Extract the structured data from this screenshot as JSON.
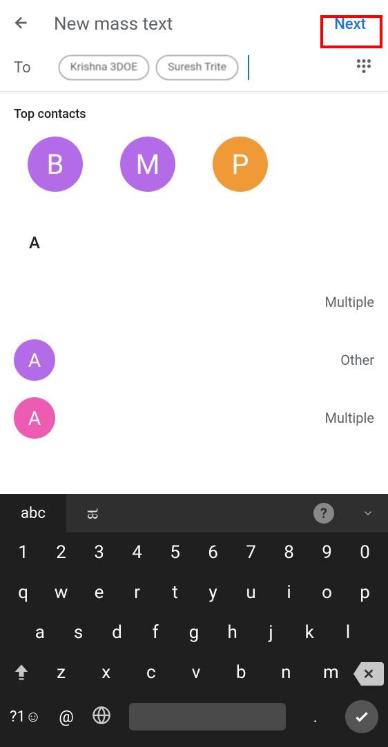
{
  "header": {
    "title": "New mass text",
    "next": "Next"
  },
  "to_label": "To",
  "chips": [
    "Krishna 3DOE",
    "Suresh Trite"
  ],
  "top_contacts_label": "Top contacts",
  "top_contacts": [
    {
      "initial": "B",
      "color": "#b46be8"
    },
    {
      "initial": "M",
      "color": "#b46be8"
    },
    {
      "initial": "P",
      "color": "#f09a37"
    }
  ],
  "section_letter": "A",
  "contacts": [
    {
      "initial": "",
      "color": "transparent",
      "type": "Multiple"
    },
    {
      "initial": "A",
      "color": "#b46be8",
      "type": "Other"
    },
    {
      "initial": "A",
      "color": "#ec5cb2",
      "type": "Multiple"
    }
  ],
  "keyboard": {
    "mode": "abc",
    "lang": "ಹ",
    "row1": [
      "1",
      "2",
      "3",
      "4",
      "5",
      "6",
      "7",
      "8",
      "9",
      "0"
    ],
    "row2": [
      "q",
      "w",
      "e",
      "r",
      "t",
      "y",
      "u",
      "i",
      "o",
      "p"
    ],
    "row3": [
      "a",
      "s",
      "d",
      "f",
      "g",
      "h",
      "j",
      "k",
      "l"
    ],
    "row4": [
      "z",
      "x",
      "c",
      "v",
      "b",
      "n",
      "m"
    ],
    "sym": "?1☺",
    "at": "@",
    "period": "."
  }
}
